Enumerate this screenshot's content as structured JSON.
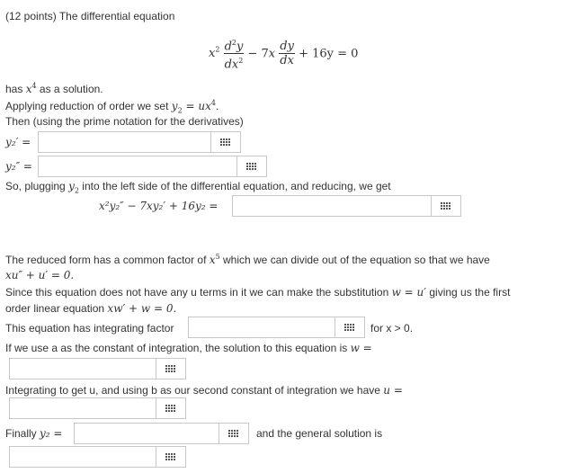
{
  "problem": {
    "points": "(12 points)",
    "intro": "The differential equation",
    "equation": {
      "x2": "x",
      "d2y": "d",
      "y": "y",
      "dx2": "dx",
      "minus": "− 7",
      "dy": "dy",
      "dx": "dx",
      "tail": "+ 16y = 0"
    },
    "has_text": "has",
    "has_sol": "as a solution.",
    "reduction": "Applying reduction of order we set",
    "then_text": "Then (using the prime notation for the derivatives)",
    "y2p_label": "y₂′ =",
    "y2pp_label": "y₂″ =",
    "plugging": "So, plugging",
    "plugging_after": "into the left side of the differential equation, and reducing, we get",
    "lhs": "x²y₂″ − 7xy₂′ + 16y₂ =",
    "reduced_a": "The reduced form has a common factor of",
    "reduced_b": "which we can divide out of the equation so that we have",
    "reduced_eq": "xu″ + u′ = 0.",
    "since_a": "Since this equation does not have any u terms in it we can make the substitution",
    "since_sub": "w = u′",
    "since_b": "giving us the first",
    "order_a": "order linear equation",
    "order_eq": "xw′ + w = 0.",
    "integ_factor": "This equation has integrating factor",
    "for_x": "for x > 0.",
    "const_a": "If we use a as the constant of integration, the solution to this equation is",
    "w_eq": "w =",
    "integ_u": "Integrating to get u, and using b as our second constant of integration we have",
    "u_eq": "u =",
    "finally": "Finally",
    "y2_eq": "y₂ =",
    "general": "and the general solution is"
  },
  "inputs": {
    "y2p": "",
    "y2pp": "",
    "lhs": "",
    "integ": "",
    "w": "",
    "u": "",
    "y2": "",
    "general": ""
  }
}
